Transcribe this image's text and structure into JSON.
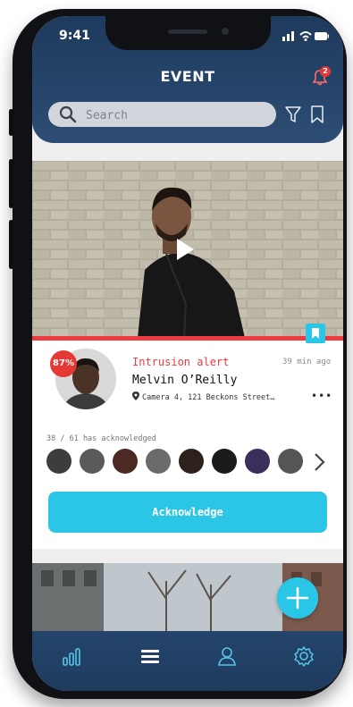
{
  "status": {
    "time": "9:41"
  },
  "header": {
    "title": "EVENT",
    "notification_count": "2",
    "search_placeholder": "Search"
  },
  "event": {
    "alert_type": "Intrusion alert",
    "time_ago": "39 min ago",
    "person_name": "Melvin O’Reilly",
    "location": "Camera 4, 121 Beckons Street…",
    "match_percent": "87%",
    "more_label": "•••",
    "acknowledged_text": "38 / 61 has acknowledged",
    "acknowledge_label": "Acknowledge"
  },
  "tabs": [
    "stats",
    "events",
    "profile",
    "settings"
  ],
  "colors": {
    "accent": "#29c6e8",
    "alert": "#ef3b40",
    "header": "#1e3a5c"
  }
}
